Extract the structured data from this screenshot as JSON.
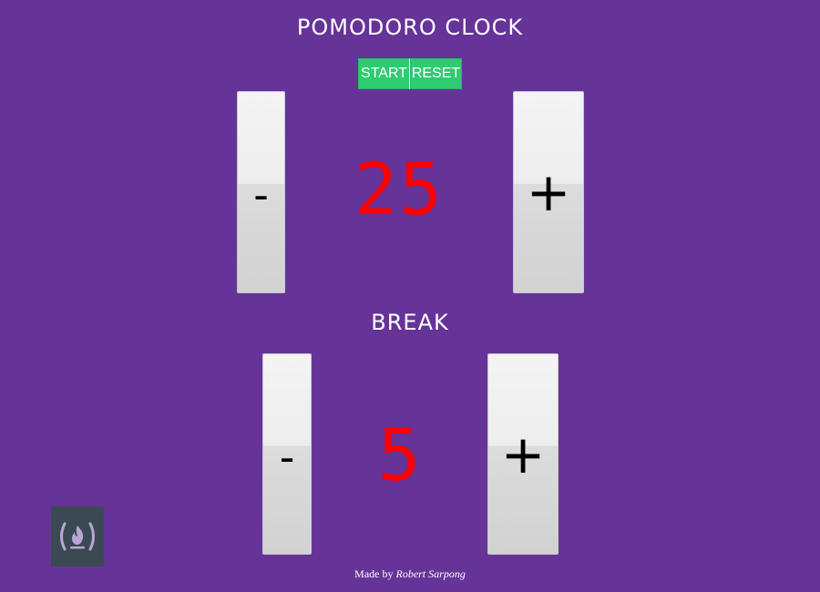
{
  "app": {
    "title": "POMODORO CLOCK"
  },
  "controls": {
    "start_label": "START",
    "reset_label": "RESET"
  },
  "session": {
    "minus_symbol": "-",
    "value": "25",
    "plus_symbol": "+"
  },
  "break": {
    "label": "BREAK",
    "minus_symbol": "-",
    "value": "5",
    "plus_symbol": "+"
  },
  "footer": {
    "prefix": "Made by",
    "author": "Robert Sarpong"
  },
  "badge": {
    "icon": "freecodecamp-icon"
  },
  "colors": {
    "background": "#663399",
    "button_green": "#2ecc71",
    "value_red": "#ff0000",
    "badge_bg": "#3b4a52"
  }
}
